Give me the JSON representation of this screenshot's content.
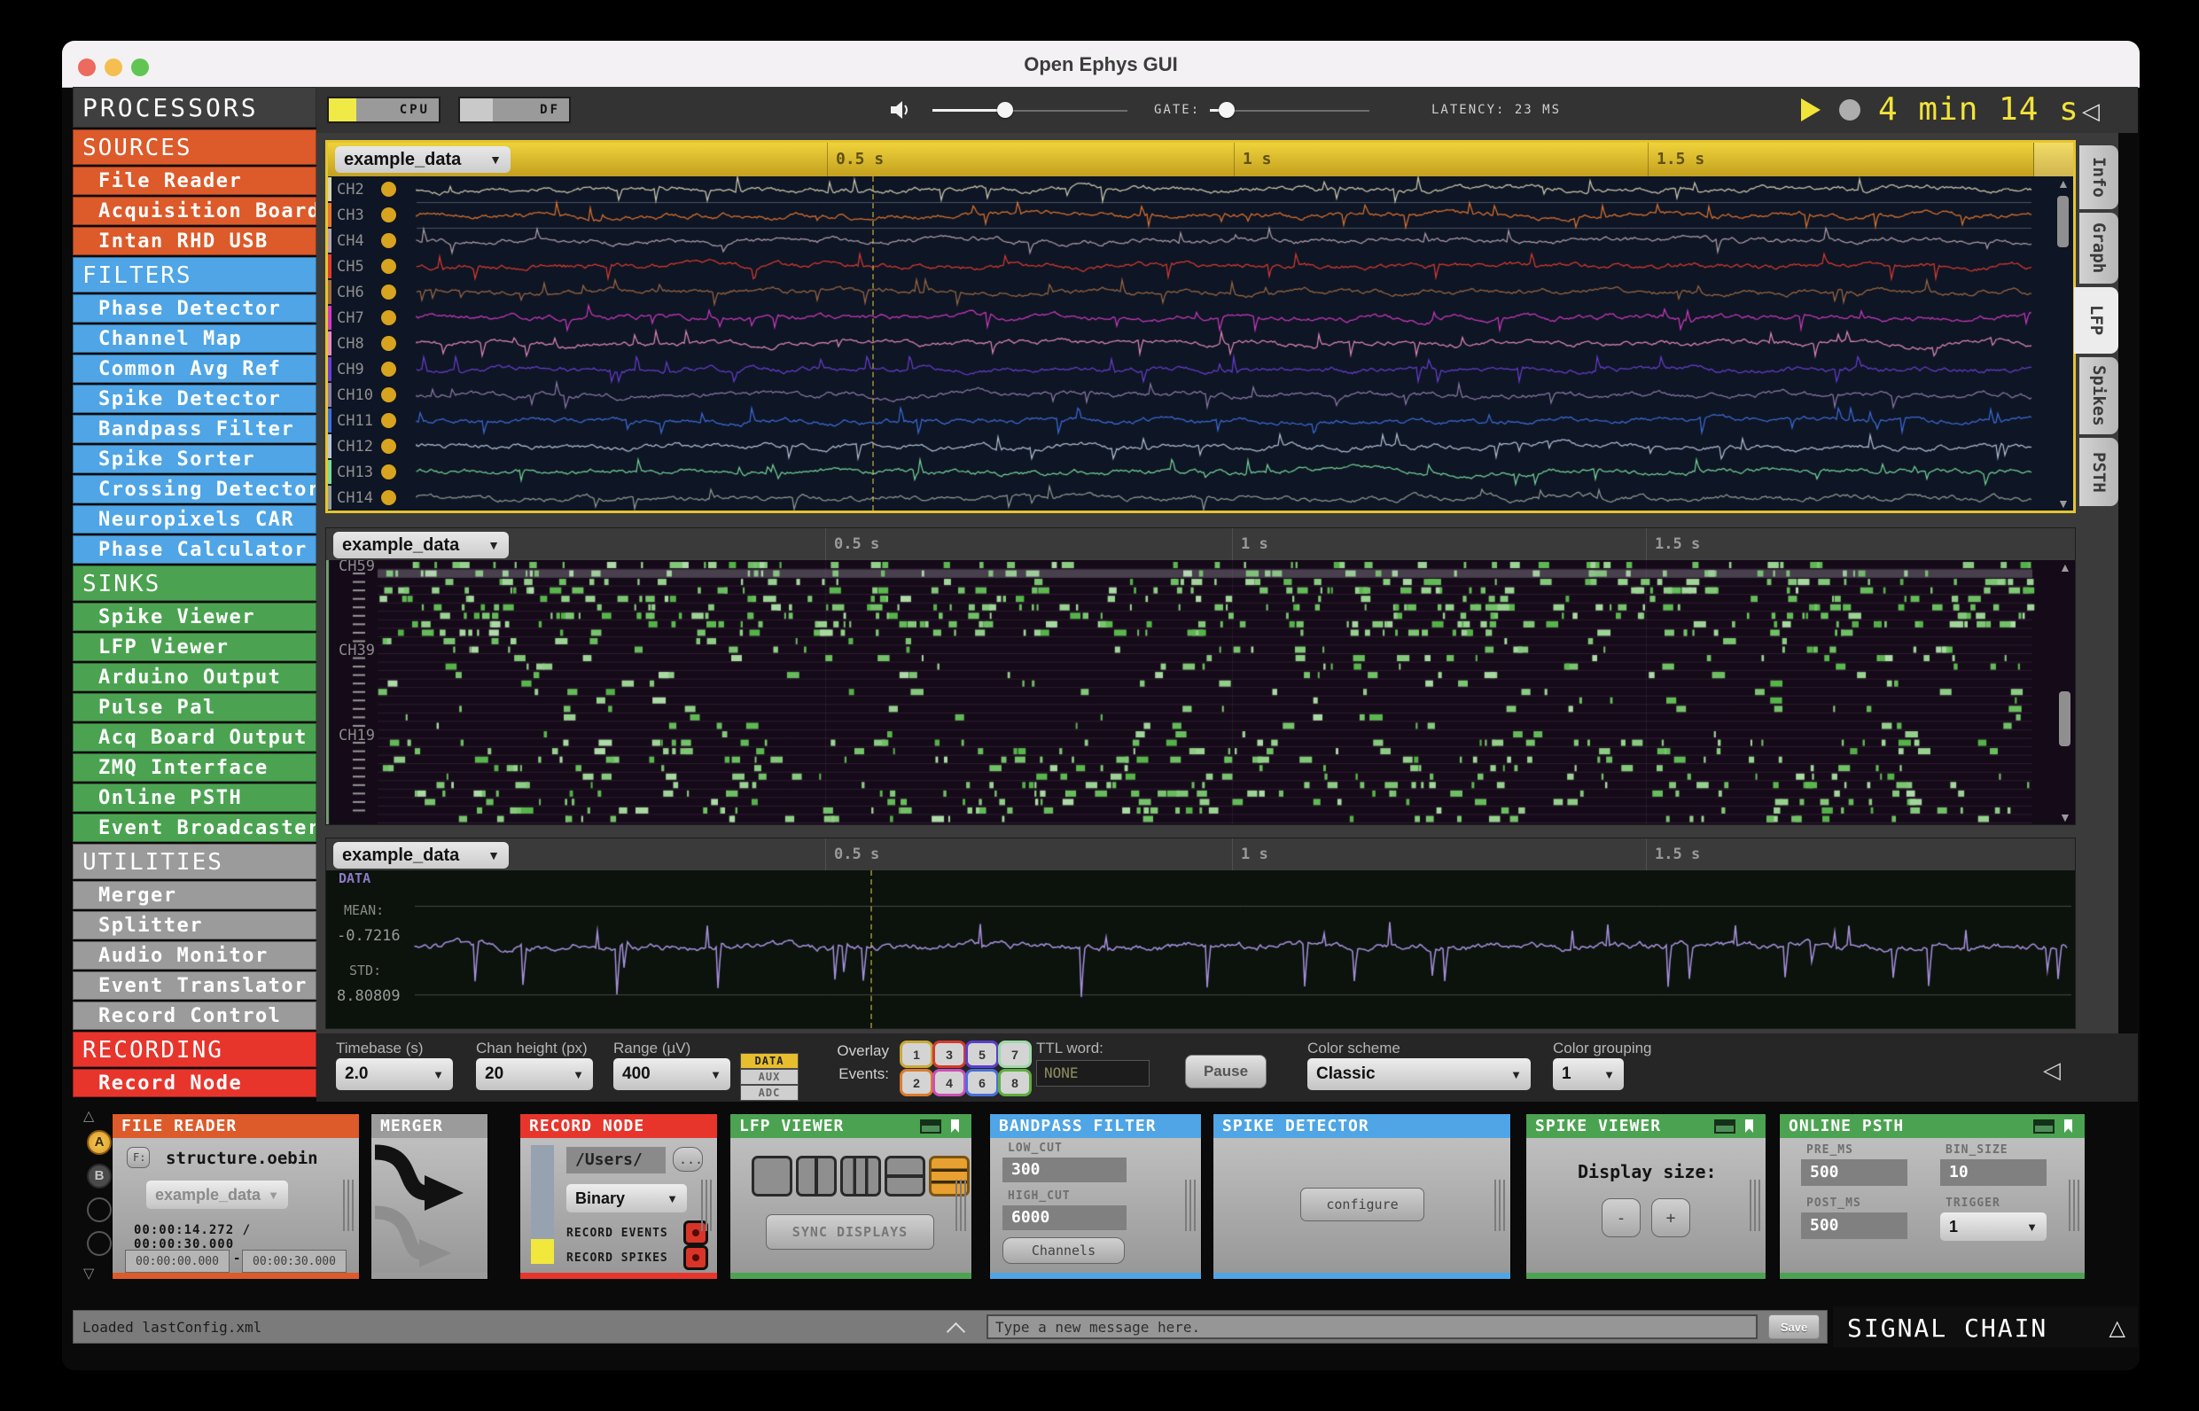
{
  "colors": {
    "accent_yellow": "#EFD23B",
    "sources_orange": "#DD5A2A",
    "filters_blue": "#4FA5E5",
    "sinks_green": "#4BA351",
    "utilities_gray": "#9B9B9B",
    "recording_red": "#E8352C",
    "timer_yellow": "#F2E33A",
    "lfp_bg": "#0E1524",
    "raster_bg": "#150A18",
    "data_bg": "#0B130C",
    "trace_purple": "#A991E0",
    "raster_green": "#7FC97F",
    "gold_circle": "#D8A31E"
  },
  "window": {
    "title": "Open Ephys GUI"
  },
  "topbar": {
    "cpu_label": "CPU",
    "df_label": "DF",
    "gate_label": "GATE:",
    "latency": "LATENCY: 23 MS",
    "timer": "4 min 14 s"
  },
  "sidebar": {
    "title": "PROCESSORS",
    "sections": [
      {
        "header": "SOURCES",
        "color": "#DD5A2A",
        "items": [
          "File Reader",
          "Acquisition Board",
          "Intan RHD USB"
        ]
      },
      {
        "header": "FILTERS",
        "color": "#4FA5E5",
        "items": [
          "Phase Detector",
          "Channel Map",
          "Common Avg Ref",
          "Spike Detector",
          "Bandpass Filter",
          "Spike Sorter",
          "Crossing Detector",
          "Neuropixels CAR",
          "Phase Calculator"
        ]
      },
      {
        "header": "SINKS",
        "color": "#4BA351",
        "items": [
          "Spike Viewer",
          "LFP Viewer",
          "Arduino Output",
          "Pulse Pal",
          "Acq Board Output",
          "ZMQ Interface",
          "Online PSTH",
          "Event Broadcaster"
        ]
      },
      {
        "header": "UTILITIES",
        "color": "#9B9B9B",
        "items": [
          "Merger",
          "Splitter",
          "Audio Monitor",
          "Event Translator",
          "Record Control"
        ]
      },
      {
        "header": "RECORDING",
        "color": "#E8352C",
        "items": [
          "Record Node"
        ]
      }
    ]
  },
  "tabs": {
    "items": [
      "Info",
      "Graph",
      "LFP",
      "Spikes",
      "PSTH"
    ],
    "selected": "LFP"
  },
  "viewer": {
    "time_ticks": [
      "0.5 s",
      "1 s",
      "1.5 s"
    ],
    "panel1": {
      "source": "example_data",
      "channels": [
        {
          "label": "CH2",
          "color": "#D6D3B6"
        },
        {
          "label": "CH3",
          "color": "#E6772E"
        },
        {
          "label": "CH4",
          "color": "#B5A3B0"
        },
        {
          "label": "CH5",
          "color": "#E03C32"
        },
        {
          "label": "CH6",
          "color": "#A06C44"
        },
        {
          "label": "CH7",
          "color": "#D13BC4"
        },
        {
          "label": "CH8",
          "color": "#E78CC2"
        },
        {
          "label": "CH9",
          "color": "#6A3FD6"
        },
        {
          "label": "CH10",
          "color": "#8F7CAD"
        },
        {
          "label": "CH11",
          "color": "#3E6FE0"
        },
        {
          "label": "CH12",
          "color": "#B8C6DE"
        },
        {
          "label": "CH13",
          "color": "#79DB9C"
        },
        {
          "label": "CH14",
          "color": "#969E9B"
        }
      ]
    },
    "panel2": {
      "source": "example_data",
      "row_labels": [
        "CH59",
        "CH39",
        "CH19"
      ]
    },
    "panel3": {
      "source": "example_data",
      "data_label": "DATA",
      "mean_label": "MEAN:",
      "mean_value": "-0.7216",
      "std_label": "STD:",
      "std_value": "8.80809"
    }
  },
  "controls": {
    "timebase_label": "Timebase (s)",
    "timebase_value": "2.0",
    "chan_height_label": "Chan height (px)",
    "chan_height_value": "20",
    "range_label": "Range (µV)",
    "range_value": "400",
    "range_tabs": [
      "DATA",
      "AUX",
      "ADC"
    ],
    "range_tab_selected": "DATA",
    "overlay_line1": "Overlay",
    "overlay_line2": "Events:",
    "events": [
      {
        "label": "1",
        "color": "#C9A938"
      },
      {
        "label": "3",
        "color": "#D23B2E"
      },
      {
        "label": "5",
        "color": "#5B3FC8"
      },
      {
        "label": "7",
        "color": "#9FD9A8"
      },
      {
        "label": "2",
        "color": "#DD7A2C"
      },
      {
        "label": "4",
        "color": "#CC4FB8"
      },
      {
        "label": "6",
        "color": "#4A6FD8"
      },
      {
        "label": "8",
        "color": "#5FAE3F"
      }
    ],
    "ttl_label": "TTL word:",
    "ttl_value": "NONE",
    "pause_label": "Pause",
    "scheme_label": "Color scheme",
    "scheme_value": "Classic",
    "grouping_label": "Color grouping",
    "grouping_value": "1"
  },
  "chain": {
    "ab_labels": [
      "A",
      "B"
    ],
    "file_reader": {
      "title": "FILE READER",
      "f_button": "F:",
      "filename": "structure.oebin",
      "source": "example_data",
      "elapsed": "00:00:14.272",
      "divider": "/",
      "total": "00:00:30.000",
      "start": "00:00:00.000",
      "dash": "-",
      "end": "00:00:30.000"
    },
    "merger": {
      "title": "MERGER"
    },
    "record_node": {
      "title": "RECORD NODE",
      "path": "/Users/",
      "browse": "...",
      "engine": "Binary",
      "record_events": "RECORD EVENTS",
      "record_spikes": "RECORD SPIKES"
    },
    "lfp_viewer": {
      "title": "LFP VIEWER",
      "sync": "SYNC DISPLAYS"
    },
    "bandpass": {
      "title": "BANDPASS FILTER",
      "low_label": "LOW_CUT",
      "low_value": "300",
      "high_label": "HIGH_CUT",
      "high_value": "6000",
      "channels": "Channels"
    },
    "spike_detector": {
      "title": "SPIKE DETECTOR",
      "configure": "configure"
    },
    "spike_viewer": {
      "title": "SPIKE VIEWER",
      "display_size": "Display size:",
      "minus": "-",
      "plus": "+"
    },
    "online_psth": {
      "title": "ONLINE PSTH",
      "pre_label": "PRE_MS",
      "pre_value": "500",
      "bin_label": "BIN_SIZE",
      "bin_value": "10",
      "post_label": "POST_MS",
      "post_value": "500",
      "trigger_label": "TRIGGER",
      "trigger_value": "1"
    }
  },
  "statusbar": {
    "status": "Loaded lastConfig.xml",
    "message_placeholder": "Type a new message here.",
    "save": "Save",
    "signal_chain": "SIGNAL CHAIN"
  }
}
